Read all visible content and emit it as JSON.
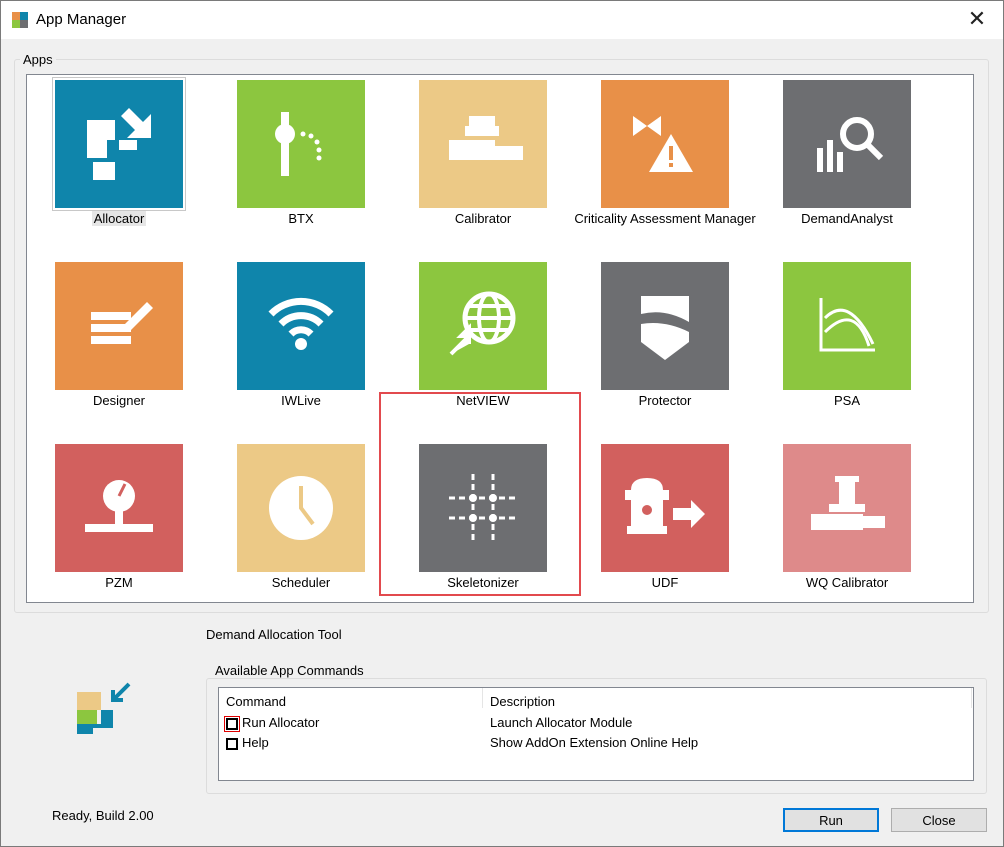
{
  "window": {
    "title": "App Manager",
    "close_glyph": "✕"
  },
  "apps_group": {
    "label": "Apps"
  },
  "apps": [
    {
      "label": "Allocator",
      "color": "#0f85ab",
      "icon": "allocator-icon"
    },
    {
      "label": "BTX",
      "color": "#8cc63f",
      "icon": "btx-icon"
    },
    {
      "label": "Calibrator",
      "color": "#ecc986",
      "icon": "calibrator-icon"
    },
    {
      "label": "Criticality Assessment Manager",
      "color": "#e89048",
      "icon": "criticality-icon"
    },
    {
      "label": "DemandAnalyst",
      "color": "#6d6e71",
      "icon": "demand-analyst-icon"
    },
    {
      "label": "Designer",
      "color": "#e89048",
      "icon": "designer-icon"
    },
    {
      "label": "IWLive",
      "color": "#0f85ab",
      "icon": "iwlive-icon"
    },
    {
      "label": "NetVIEW",
      "color": "#8cc63f",
      "icon": "netview-icon"
    },
    {
      "label": "Protector",
      "color": "#6d6e71",
      "icon": "protector-icon"
    },
    {
      "label": "PSA",
      "color": "#8cc63f",
      "icon": "psa-icon"
    },
    {
      "label": "PZM",
      "color": "#d2605e",
      "icon": "pzm-icon"
    },
    {
      "label": "Scheduler",
      "color": "#ecc986",
      "icon": "scheduler-icon"
    },
    {
      "label": "Skeletonizer",
      "color": "#6d6e71",
      "icon": "skeletonizer-icon"
    },
    {
      "label": "UDF",
      "color": "#d2605e",
      "icon": "udf-icon"
    },
    {
      "label": "WQ Calibrator",
      "color": "#de8a8a",
      "icon": "wq-calibrator-icon"
    }
  ],
  "selected_app": {
    "description": "Demand Allocation Tool"
  },
  "commands_group": {
    "label": "Available App Commands",
    "columns": [
      "Command",
      "Description"
    ],
    "rows": [
      {
        "command": "Run Allocator",
        "description": "Launch Allocator Module"
      },
      {
        "command": "Help",
        "description": "Show AddOn Extension Online Help"
      }
    ]
  },
  "status": "Ready, Build 2.00",
  "buttons": {
    "run": "Run",
    "close": "Close"
  }
}
